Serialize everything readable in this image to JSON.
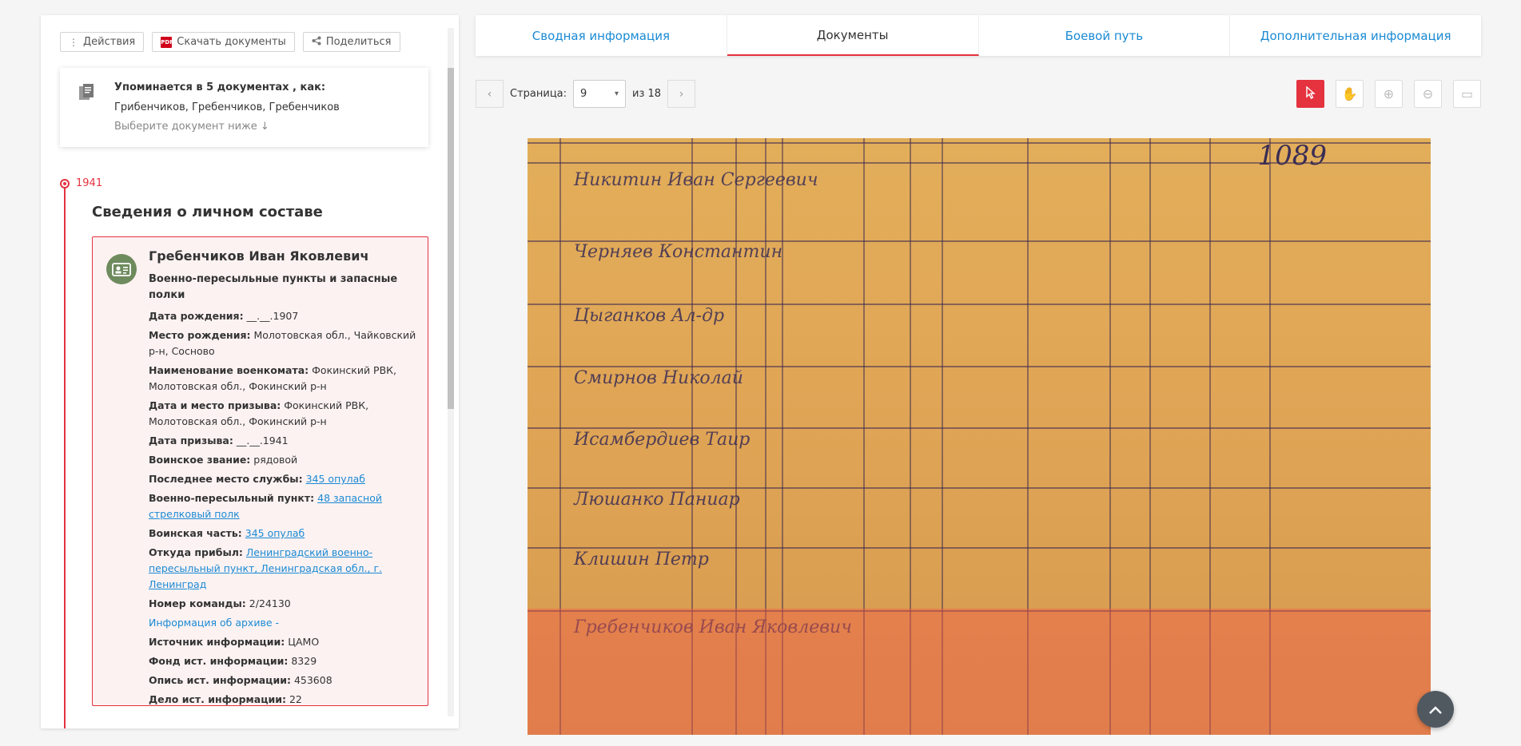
{
  "actions": {
    "actions_label": "Действия",
    "download_label": "Скачать документы",
    "share_label": "Поделиться"
  },
  "mention": {
    "title": "Упоминается в 5 документах , как:",
    "names": "Грибенчиков, Гребенчиков, Гребенчиков",
    "hint": "Выберите документ ниже ↓"
  },
  "timeline": {
    "year": "1941",
    "section_title": "Сведения о личном составе"
  },
  "person": {
    "name": "Гребенчиков Иван Яковлевич",
    "subtitle": "Военно-пересыльные пункты и запасные полки",
    "rows": [
      {
        "label": "Дата рождения:",
        "value": "__.__.1907"
      },
      {
        "label": "Место рождения:",
        "value": "Молотовская обл., Чайковский р-н, Сосново"
      },
      {
        "label": "Наименование военкомата:",
        "value": "Фокинский РВК, Молотовская обл., Фокинский р-н"
      },
      {
        "label": "Дата и место призыва:",
        "value": "Фокинский РВК, Молотовская обл., Фокинский р-н"
      },
      {
        "label": "Дата призыва:",
        "value": "__.__.1941"
      },
      {
        "label": "Воинское звание:",
        "value": "рядовой"
      }
    ],
    "link_rows": [
      {
        "label": "Последнее место службы:",
        "value": "345 опулаб"
      },
      {
        "label": "Военно-пересыльный пункт:",
        "value": "48 запасной стрелковый полк"
      },
      {
        "label": "Воинская часть:",
        "value": "345 опулаб"
      },
      {
        "label": "Откуда прибыл:",
        "value": "Ленинградский военно-пересыльный пункт, Ленинградская обл., г. Ленинград"
      }
    ],
    "team_label": "Номер команды:",
    "team_value": "2/24130",
    "archive_link": "Информация об архиве -",
    "archive_rows": [
      {
        "label": "Источник информации:",
        "value": "ЦАМО"
      },
      {
        "label": "Фонд ист. информации:",
        "value": "8329"
      },
      {
        "label": "Опись ист. информации:",
        "value": "453608"
      },
      {
        "label": "Дело ист. информации:",
        "value": "22"
      }
    ]
  },
  "tabs": [
    "Сводная информация",
    "Документы",
    "Боевой путь",
    "Дополнительная информация"
  ],
  "active_tab": "Документы",
  "pager": {
    "page_label": "Страница:",
    "page_value": "9",
    "total_label": "из 18"
  },
  "document": {
    "sheet_number": "1089",
    "highlighted_row_name": "Гребенчиков"
  },
  "colors": {
    "accent": "#e4323f",
    "link": "#1a8ad4",
    "avatar": "#6e8b5e"
  }
}
